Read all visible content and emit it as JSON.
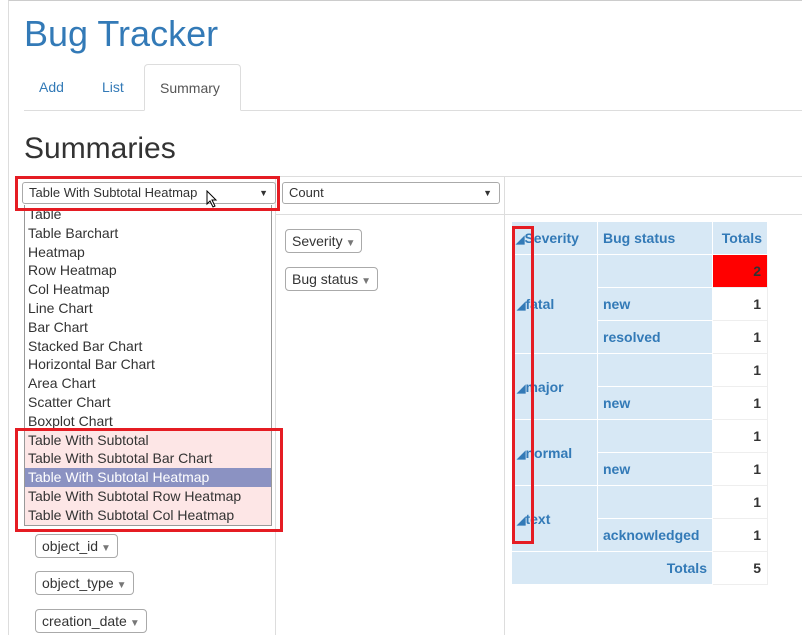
{
  "app": {
    "title": "Bug Tracker"
  },
  "tabs": [
    {
      "label": "Add"
    },
    {
      "label": "List"
    },
    {
      "label": "Summary"
    }
  ],
  "section_title": "Summaries",
  "renderer_select": {
    "value": "Table With Subtotal Heatmap"
  },
  "aggregator_select": {
    "value": "Count"
  },
  "renderer_options": [
    "Table",
    "Table Barchart",
    "Heatmap",
    "Row Heatmap",
    "Col Heatmap",
    "Line Chart",
    "Bar Chart",
    "Stacked Bar Chart",
    "Horizontal Bar Chart",
    "Area Chart",
    "Scatter Chart",
    "Boxplot Chart",
    "Table With Subtotal",
    "Table With Subtotal Bar Chart",
    "Table With Subtotal Heatmap",
    "Table With Subtotal Row Heatmap",
    "Table With Subtotal Col Heatmap"
  ],
  "highlighted_options": [
    "Table With Subtotal",
    "Table With Subtotal Bar Chart",
    "Table With Subtotal Heatmap",
    "Table With Subtotal Row Heatmap",
    "Table With Subtotal Col Heatmap"
  ],
  "selected_option": "Table With Subtotal Heatmap",
  "row_fields": [
    "Severity",
    "Bug status"
  ],
  "unused_fields": [
    "object_id",
    "object_type",
    "creation_date"
  ],
  "table": {
    "headers": {
      "severity": "Severity",
      "status": "Bug status",
      "totals": "Totals"
    },
    "groups": [
      {
        "severity": "fatal",
        "subtotal": "2",
        "rows": [
          {
            "status": "new",
            "value": "1"
          },
          {
            "status": "resolved",
            "value": "1"
          }
        ]
      },
      {
        "severity": "major",
        "subtotal": "1",
        "rows": [
          {
            "status": "new",
            "value": "1"
          }
        ]
      },
      {
        "severity": "normal",
        "subtotal": "1",
        "rows": [
          {
            "status": "new",
            "value": "1"
          }
        ]
      },
      {
        "severity": "text",
        "subtotal": "1",
        "rows": [
          {
            "status": "acknowledged",
            "value": "1"
          }
        ]
      }
    ],
    "totals_label": "Totals",
    "grand_total": "5",
    "toggle_glyph": "◢"
  },
  "colors": {
    "accent": "#337ab7",
    "highlight_box": "#e51c23",
    "heat_max": "#ff0000",
    "header_bg": "#d7e8f5"
  }
}
